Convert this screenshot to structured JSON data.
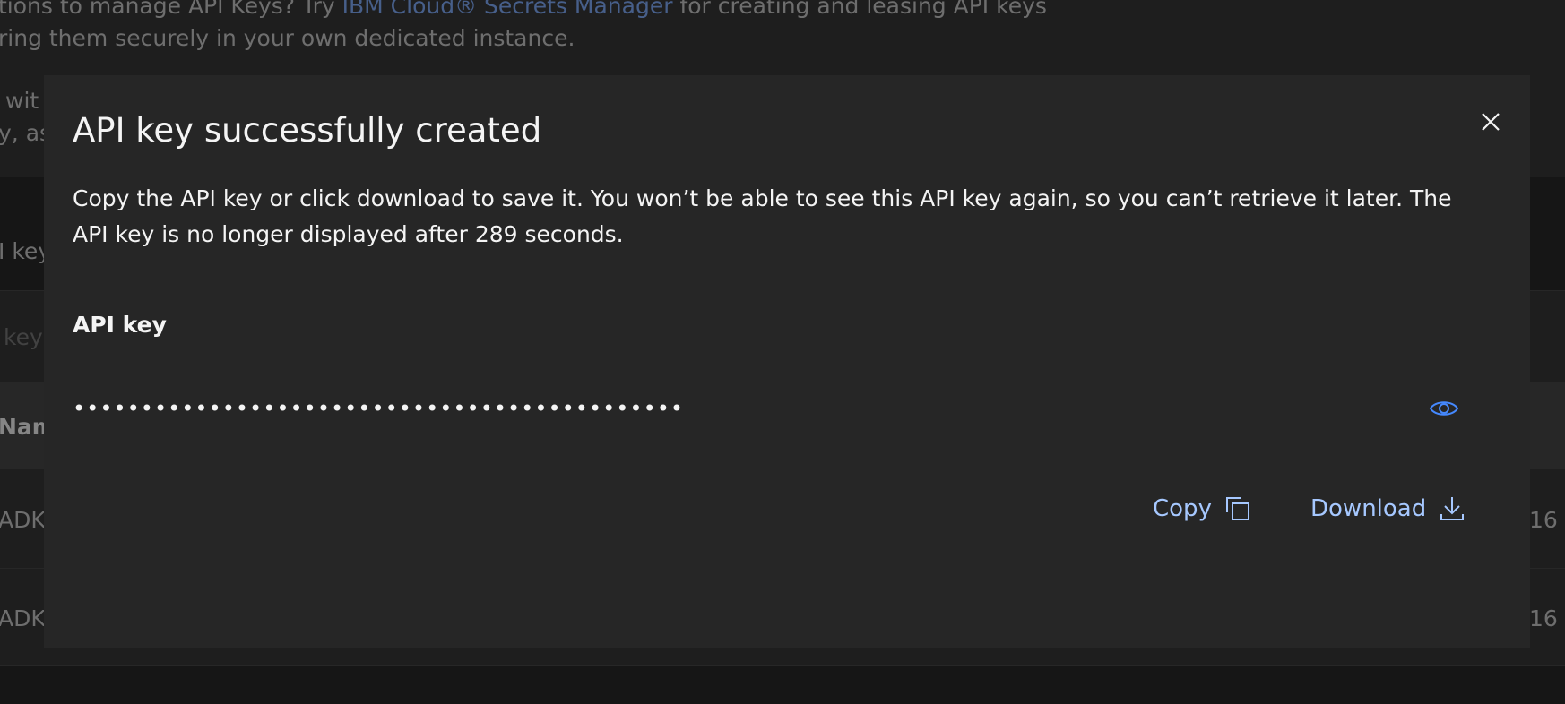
{
  "background": {
    "notice_line1_prefix": "tions to manage API Keys? Try ",
    "notice_link": "IBM Cloud® Secrets Manager",
    "notice_line1_suffix": " for creating and leasing API keys",
    "notice_line2": "ring them securely in your own dedicated instance.",
    "fragment_1": "wit",
    "fragment_2": "y, as",
    "fragment_3": "I key",
    "fragment_4": "key",
    "column_name": "Nam",
    "row_1_name": "ADK",
    "row_1_value": "16",
    "row_2_name": "ADK",
    "row_2_value": "16"
  },
  "modal": {
    "title": "API key successfully created",
    "body": "Copy the API key or click download to save it. You won’t be able to see this API key again, so you can’t retrieve it later. The API key is no longer displayed after 289 seconds.",
    "field_label": "API key",
    "key_masked": "•••••••••••••••••••••••••••••••••••••••••••••",
    "copy_label": "Copy",
    "download_label": "Download"
  },
  "icons": {
    "close": "close-icon",
    "eye": "eye-icon",
    "copy": "copy-icon",
    "download": "download-icon"
  },
  "colors": {
    "modal_bg": "#262626",
    "link_accent": "#a6c8ff",
    "eye_icon": "#4589ff"
  }
}
